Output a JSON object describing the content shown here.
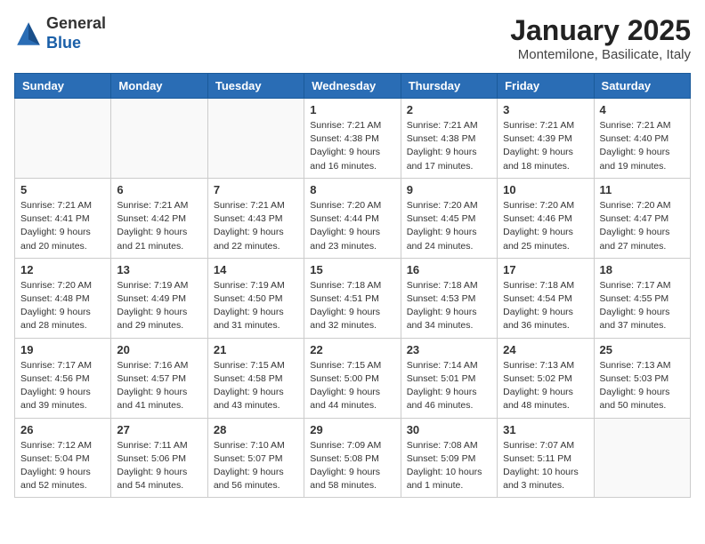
{
  "logo": {
    "general": "General",
    "blue": "Blue"
  },
  "title": "January 2025",
  "subtitle": "Montemilone, Basilicate, Italy",
  "days_of_week": [
    "Sunday",
    "Monday",
    "Tuesday",
    "Wednesday",
    "Thursday",
    "Friday",
    "Saturday"
  ],
  "weeks": [
    [
      {
        "day": "",
        "info": ""
      },
      {
        "day": "",
        "info": ""
      },
      {
        "day": "",
        "info": ""
      },
      {
        "day": "1",
        "info": "Sunrise: 7:21 AM\nSunset: 4:38 PM\nDaylight: 9 hours and 16 minutes."
      },
      {
        "day": "2",
        "info": "Sunrise: 7:21 AM\nSunset: 4:38 PM\nDaylight: 9 hours and 17 minutes."
      },
      {
        "day": "3",
        "info": "Sunrise: 7:21 AM\nSunset: 4:39 PM\nDaylight: 9 hours and 18 minutes."
      },
      {
        "day": "4",
        "info": "Sunrise: 7:21 AM\nSunset: 4:40 PM\nDaylight: 9 hours and 19 minutes."
      }
    ],
    [
      {
        "day": "5",
        "info": "Sunrise: 7:21 AM\nSunset: 4:41 PM\nDaylight: 9 hours and 20 minutes."
      },
      {
        "day": "6",
        "info": "Sunrise: 7:21 AM\nSunset: 4:42 PM\nDaylight: 9 hours and 21 minutes."
      },
      {
        "day": "7",
        "info": "Sunrise: 7:21 AM\nSunset: 4:43 PM\nDaylight: 9 hours and 22 minutes."
      },
      {
        "day": "8",
        "info": "Sunrise: 7:20 AM\nSunset: 4:44 PM\nDaylight: 9 hours and 23 minutes."
      },
      {
        "day": "9",
        "info": "Sunrise: 7:20 AM\nSunset: 4:45 PM\nDaylight: 9 hours and 24 minutes."
      },
      {
        "day": "10",
        "info": "Sunrise: 7:20 AM\nSunset: 4:46 PM\nDaylight: 9 hours and 25 minutes."
      },
      {
        "day": "11",
        "info": "Sunrise: 7:20 AM\nSunset: 4:47 PM\nDaylight: 9 hours and 27 minutes."
      }
    ],
    [
      {
        "day": "12",
        "info": "Sunrise: 7:20 AM\nSunset: 4:48 PM\nDaylight: 9 hours and 28 minutes."
      },
      {
        "day": "13",
        "info": "Sunrise: 7:19 AM\nSunset: 4:49 PM\nDaylight: 9 hours and 29 minutes."
      },
      {
        "day": "14",
        "info": "Sunrise: 7:19 AM\nSunset: 4:50 PM\nDaylight: 9 hours and 31 minutes."
      },
      {
        "day": "15",
        "info": "Sunrise: 7:18 AM\nSunset: 4:51 PM\nDaylight: 9 hours and 32 minutes."
      },
      {
        "day": "16",
        "info": "Sunrise: 7:18 AM\nSunset: 4:53 PM\nDaylight: 9 hours and 34 minutes."
      },
      {
        "day": "17",
        "info": "Sunrise: 7:18 AM\nSunset: 4:54 PM\nDaylight: 9 hours and 36 minutes."
      },
      {
        "day": "18",
        "info": "Sunrise: 7:17 AM\nSunset: 4:55 PM\nDaylight: 9 hours and 37 minutes."
      }
    ],
    [
      {
        "day": "19",
        "info": "Sunrise: 7:17 AM\nSunset: 4:56 PM\nDaylight: 9 hours and 39 minutes."
      },
      {
        "day": "20",
        "info": "Sunrise: 7:16 AM\nSunset: 4:57 PM\nDaylight: 9 hours and 41 minutes."
      },
      {
        "day": "21",
        "info": "Sunrise: 7:15 AM\nSunset: 4:58 PM\nDaylight: 9 hours and 43 minutes."
      },
      {
        "day": "22",
        "info": "Sunrise: 7:15 AM\nSunset: 5:00 PM\nDaylight: 9 hours and 44 minutes."
      },
      {
        "day": "23",
        "info": "Sunrise: 7:14 AM\nSunset: 5:01 PM\nDaylight: 9 hours and 46 minutes."
      },
      {
        "day": "24",
        "info": "Sunrise: 7:13 AM\nSunset: 5:02 PM\nDaylight: 9 hours and 48 minutes."
      },
      {
        "day": "25",
        "info": "Sunrise: 7:13 AM\nSunset: 5:03 PM\nDaylight: 9 hours and 50 minutes."
      }
    ],
    [
      {
        "day": "26",
        "info": "Sunrise: 7:12 AM\nSunset: 5:04 PM\nDaylight: 9 hours and 52 minutes."
      },
      {
        "day": "27",
        "info": "Sunrise: 7:11 AM\nSunset: 5:06 PM\nDaylight: 9 hours and 54 minutes."
      },
      {
        "day": "28",
        "info": "Sunrise: 7:10 AM\nSunset: 5:07 PM\nDaylight: 9 hours and 56 minutes."
      },
      {
        "day": "29",
        "info": "Sunrise: 7:09 AM\nSunset: 5:08 PM\nDaylight: 9 hours and 58 minutes."
      },
      {
        "day": "30",
        "info": "Sunrise: 7:08 AM\nSunset: 5:09 PM\nDaylight: 10 hours and 1 minute."
      },
      {
        "day": "31",
        "info": "Sunrise: 7:07 AM\nSunset: 5:11 PM\nDaylight: 10 hours and 3 minutes."
      },
      {
        "day": "",
        "info": ""
      }
    ]
  ]
}
